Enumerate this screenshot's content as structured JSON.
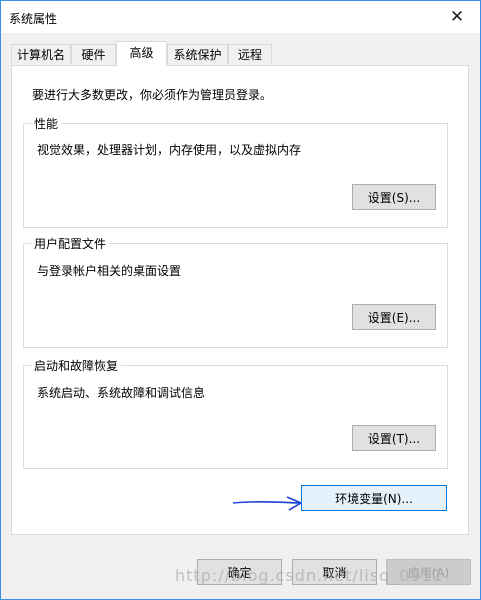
{
  "window": {
    "title": "系统属性"
  },
  "tabs": [
    {
      "label": "计算机名"
    },
    {
      "label": "硬件"
    },
    {
      "label": "高级"
    },
    {
      "label": "系统保护"
    },
    {
      "label": "远程"
    }
  ],
  "notice": "要进行大多数更改，你必须作为管理员登录。",
  "groups": {
    "performance": {
      "title": "性能",
      "desc": "视觉效果，处理器计划，内存使用，以及虚拟内存",
      "button": "设置(S)..."
    },
    "profile": {
      "title": "用户配置文件",
      "desc": "与登录帐户相关的桌面设置",
      "button": "设置(E)..."
    },
    "startup": {
      "title": "启动和故障恢复",
      "desc": "系统启动、系统故障和调试信息",
      "button": "设置(T)..."
    }
  },
  "env_button": "环境变量(N)...",
  "footer": {
    "ok": "确定",
    "cancel": "取消",
    "apply": "应用(A)"
  },
  "watermark": "http://blog.csdn.net/lisq_0911",
  "colors": {
    "accent": "#0078d7",
    "annotation": "#1a3fd6"
  }
}
